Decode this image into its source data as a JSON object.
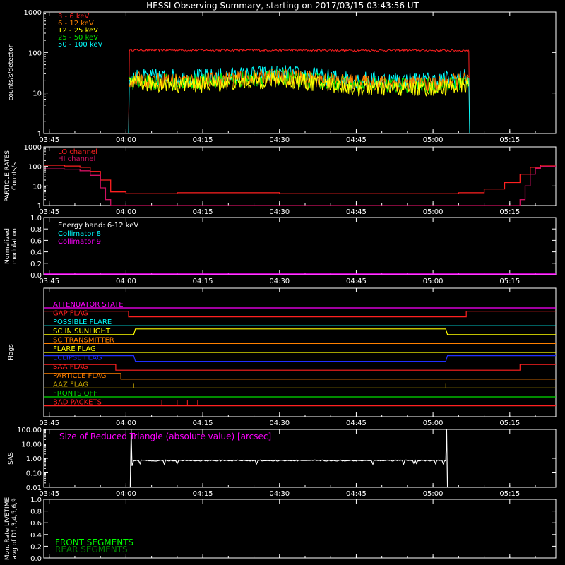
{
  "title": "HESSI Observing Summary, starting on 2017/03/15 03:43:56 UT",
  "time_ticks": [
    "03:45",
    "04:00",
    "04:15",
    "04:30",
    "04:45",
    "05:00",
    "05:15"
  ],
  "chart_data": [
    {
      "id": "lightcurves",
      "type": "line",
      "ylabel": "counts/s/detector",
      "yscale": "log",
      "ylim": [
        1,
        1000
      ],
      "y_ticks": [
        "1",
        "10",
        "100",
        "1000"
      ],
      "xlim": [
        "03:43:56",
        "05:24:00"
      ],
      "legend_placement": "top-left",
      "series": [
        {
          "name": "3 - 6 keV",
          "color": "#ff2020",
          "x": [
            "03:43:56",
            "04:00:30",
            "04:00:40",
            "05:07:00",
            "05:07:10",
            "05:24:00"
          ],
          "values": [
            1,
            1,
            115,
            112,
            1,
            1
          ]
        },
        {
          "name": "6 - 12 keV",
          "color": "#ff8000",
          "x": [
            "04:00:40",
            "04:15",
            "04:30",
            "04:45",
            "05:00",
            "05:07:00"
          ],
          "values": [
            21,
            20,
            26,
            18,
            17,
            21
          ]
        },
        {
          "name": "12 - 25 keV",
          "color": "#ffff00",
          "x": [
            "04:00:40",
            "04:15",
            "04:30",
            "04:45",
            "05:00",
            "05:07:00"
          ],
          "values": [
            17,
            16,
            21,
            13,
            13,
            16
          ]
        },
        {
          "name": "25 - 50 keV",
          "color": "#00e000",
          "x": [
            "04:00:40",
            "04:15",
            "04:30",
            "04:45",
            "05:00",
            "05:07:00"
          ],
          "values": [
            19,
            19,
            24,
            16,
            15,
            19
          ]
        },
        {
          "name": "50 - 100 keV",
          "color": "#00ffff",
          "x": [
            "03:43:56",
            "04:00:30",
            "04:00:40",
            "04:15",
            "04:30",
            "04:45",
            "05:00",
            "05:07:00",
            "05:07:10",
            "05:24:00"
          ],
          "values": [
            1,
            1,
            24,
            24,
            30,
            21,
            20,
            24,
            1,
            1
          ]
        }
      ]
    },
    {
      "id": "particle_rates",
      "type": "line",
      "ylabel": "PARTICLE RATES Counts/s",
      "yscale": "log",
      "ylim": [
        1,
        1000
      ],
      "y_ticks": [
        "1",
        "10",
        "100",
        "1000"
      ],
      "series": [
        {
          "name": "LO channel",
          "color": "#ff2020",
          "x": [
            "03:43:56",
            "03:48",
            "03:51",
            "03:53",
            "03:55",
            "03:57",
            "04:00",
            "04:10",
            "04:30",
            "04:50",
            "05:00",
            "05:05",
            "05:10",
            "05:14",
            "05:17",
            "05:19",
            "05:21",
            "05:24:00"
          ],
          "values": [
            115,
            105,
            90,
            55,
            20,
            5,
            4,
            4.5,
            4,
            4,
            4,
            4.5,
            7,
            15,
            40,
            90,
            115,
            115
          ]
        },
        {
          "name": "HI channel",
          "color": "#d01060",
          "x": [
            "03:43:56",
            "03:48",
            "03:51",
            "03:53",
            "03:55",
            "03:56",
            "03:57",
            "05:16",
            "05:17",
            "05:18",
            "05:19",
            "05:20",
            "05:21",
            "05:24:00"
          ],
          "values": [
            75,
            72,
            60,
            35,
            8,
            2,
            1,
            1,
            2,
            10,
            40,
            80,
            100,
            100
          ]
        }
      ]
    },
    {
      "id": "modulation",
      "type": "line",
      "ylabel": "Normalized modulation",
      "ylim": [
        0,
        1
      ],
      "y_ticks": [
        "0.0",
        "0.2",
        "0.4",
        "0.6",
        "0.8",
        "1.0"
      ],
      "annotation": "Energy band: 6-12 keV",
      "series": [
        {
          "name": "Collimator 8",
          "color": "#00ffff",
          "x": [],
          "values": []
        },
        {
          "name": "Collimator 9",
          "color": "#ff00ff",
          "x": [
            "03:43:56",
            "05:24:00"
          ],
          "values": [
            0,
            0
          ]
        }
      ]
    },
    {
      "id": "flags",
      "type": "line",
      "ylabel": "Flags",
      "series": [
        {
          "name": "ATTENUATOR STATE",
          "color": "#ff00ff",
          "x": [
            "03:43:56",
            "05:24:00"
          ],
          "values": [
            0,
            0
          ]
        },
        {
          "name": "GAP FLAG",
          "color": "#ff2020",
          "x": [
            "03:43:56",
            "04:00:30",
            "04:00:30",
            "05:06:30",
            "05:06:30",
            "05:24:00"
          ],
          "values": [
            1,
            1,
            0,
            0,
            1,
            1
          ]
        },
        {
          "name": "POSSIBLE FLARE",
          "color": "#00ffff",
          "x": [
            "03:43:56",
            "05:24:00"
          ],
          "values": [
            0,
            0
          ]
        },
        {
          "name": "SC IN SUNLIGHT",
          "color": "#ffff00",
          "x": [
            "03:43:56",
            "04:01:30",
            "04:01:50",
            "05:02:30",
            "05:02:50",
            "05:24:00"
          ],
          "values": [
            0,
            0,
            1,
            1,
            0,
            0
          ]
        },
        {
          "name": "SC TRANSMITTER",
          "color": "#ff8000",
          "x": [
            "03:43:56",
            "05:24:00"
          ],
          "values": [
            0,
            0
          ]
        },
        {
          "name": "FLARE FLAG",
          "color": "#ffff00",
          "x": [
            "03:43:56",
            "05:24:00"
          ],
          "values": [
            0,
            0
          ]
        },
        {
          "name": "ECLIPSE FLAG",
          "color": "#2030ff",
          "x": [
            "03:43:56",
            "04:01:30",
            "04:01:50",
            "05:02:30",
            "05:02:50",
            "05:24:00"
          ],
          "values": [
            1,
            1,
            0,
            0,
            1,
            1
          ]
        },
        {
          "name": "SAA FLAG",
          "color": "#ff2020",
          "x": [
            "03:43:56",
            "03:58",
            "03:58",
            "05:17",
            "05:17",
            "05:24:00"
          ],
          "values": [
            1,
            1,
            0,
            0,
            1,
            1
          ]
        },
        {
          "name": "PARTICLE FLAG",
          "color": "#ff8000",
          "x": [
            "03:43:56",
            "03:59",
            "03:59",
            "04:00:30",
            "04:00:30",
            "05:24:00"
          ],
          "values": [
            1,
            1,
            0,
            0,
            0,
            0
          ]
        },
        {
          "name": "AAZ FLAG",
          "color": "#c0a000",
          "x": [
            "03:43:56",
            "05:24:00"
          ],
          "values": [
            0,
            0
          ]
        },
        {
          "name": "FRONTS OFF",
          "color": "#00e000",
          "x": [
            "03:43:56",
            "05:24:00"
          ],
          "values": [
            0,
            0
          ]
        },
        {
          "name": "BAD PACKETS",
          "color": "#ff2020",
          "x": [
            "03:43:56",
            "05:24:00"
          ],
          "values": [
            0,
            0
          ]
        }
      ]
    },
    {
      "id": "sas",
      "type": "line",
      "ylabel": "SAS",
      "yscale": "log",
      "ylim": [
        0.01,
        100
      ],
      "y_ticks": [
        "0.01",
        "0.10",
        "1.00",
        "10.00",
        "100.00"
      ],
      "annotation": "Size of Reduced Triangle (absolute value) [arcsec]",
      "series": [
        {
          "name": "SAS triangle",
          "color": "#ffffff",
          "x": [
            "04:01:00",
            "04:01:30",
            "04:15",
            "04:30",
            "04:45",
            "05:00",
            "05:02:30"
          ],
          "values": [
            0.6,
            0.7,
            0.7,
            0.7,
            0.7,
            0.7,
            0.7
          ]
        }
      ]
    },
    {
      "id": "livetime",
      "type": "line",
      "ylabel": "Mon. Rate LIVETIME avg of D1,3,4,5,6,9",
      "ylim": [
        0,
        1
      ],
      "y_ticks": [
        "0.0",
        "0.2",
        "0.4",
        "0.6",
        "0.8",
        "1.0"
      ],
      "series": [
        {
          "name": "FRONT SEGMENTS",
          "color": "#00ff00",
          "x": [],
          "values": []
        },
        {
          "name": "REAR SEGMENTS",
          "color": "#008000",
          "x": [],
          "values": []
        }
      ]
    }
  ]
}
